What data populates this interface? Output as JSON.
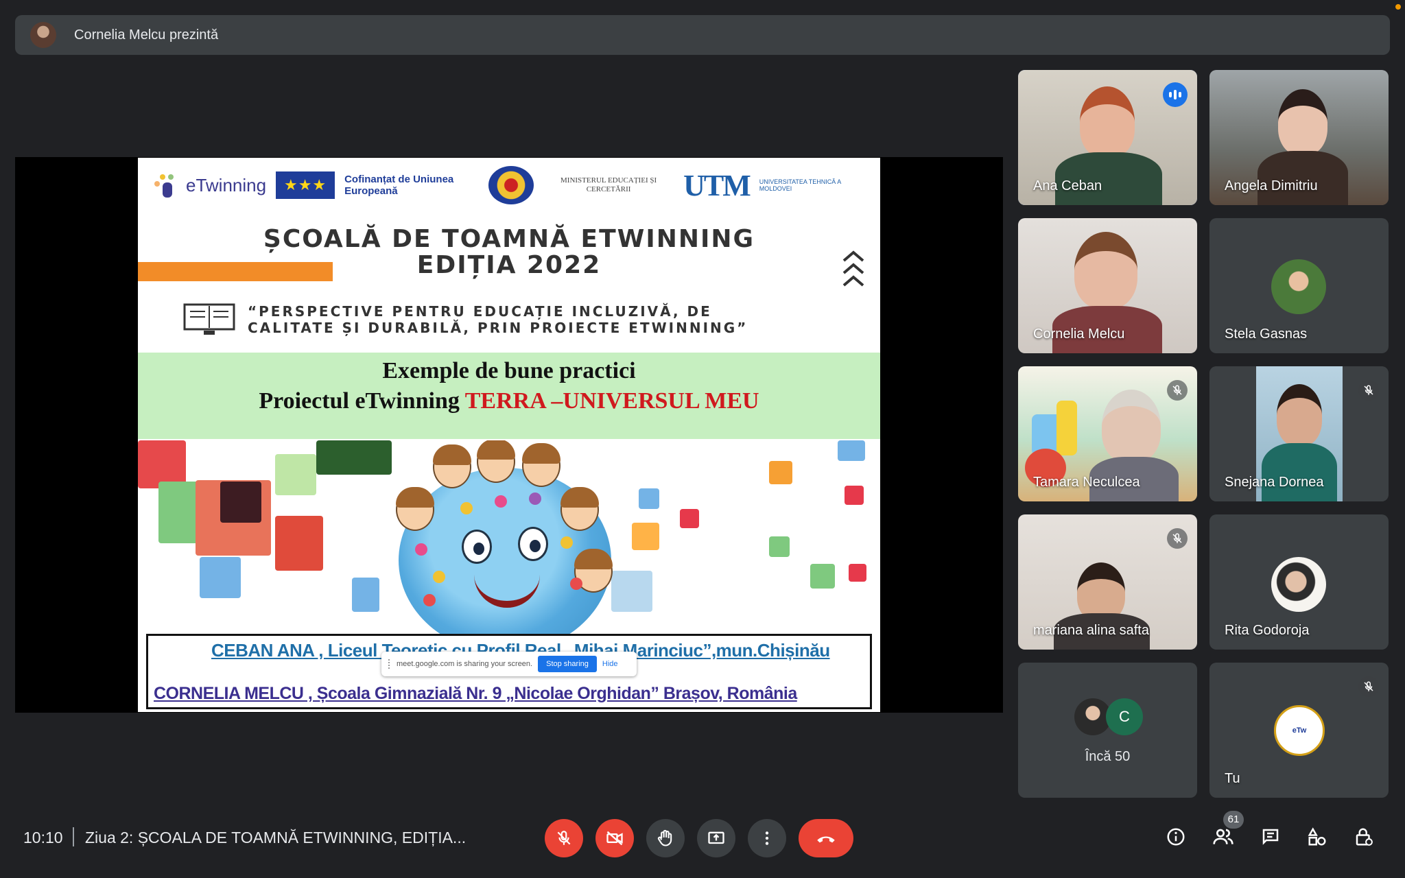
{
  "presenter": {
    "label": "Cornelia Melcu prezintă"
  },
  "slide": {
    "logos": {
      "etwinning": "eTwinning",
      "eu_text": "Cofinanțat de Uniunea Europeană",
      "ministry": "MINISTERUL EDUCAȚIEI ȘI CERCETĂRII",
      "utm": "UTM",
      "utm_text": "UNIVERSITATEA TEHNICĂ A MOLDOVEI"
    },
    "title_line1": "ȘCOALĂ DE TOAMNĂ ETWINNING",
    "title_line2": "EDIȚIA 2022",
    "subtitle_line1": "“PERSPECTIVE PENTRU EDUCAȚIE INCLUZIVĂ, DE",
    "subtitle_line2": "CALITATE ȘI DURABILĂ, PRIN PROIECTE ETWINNING”",
    "band_line1": "Exemple de bune practici",
    "band_line2_prefix": "Proiectul eTwinning ",
    "band_line2_highlight": "TERRA –UNIVERSUL MEU",
    "credit1": "CEBAN ANA , Liceul Teoretic cu Profil Real „Mihai Marinciuc”,mun.Chișinău",
    "credit2": "CORNELIA MELCU , Școala Gimnazială Nr. 9 „Nicolae Orghidan” Brașov, România"
  },
  "share_bar": {
    "message": "meet.google.com is sharing your screen.",
    "stop_label": "Stop sharing",
    "hide_label": "Hide"
  },
  "participants": [
    {
      "name": "Ana Ceban",
      "state": "speaking"
    },
    {
      "name": "Angela Dimitriu",
      "state": "video"
    },
    {
      "name": "Cornelia Melcu",
      "state": "video"
    },
    {
      "name": "Stela Gasnas",
      "state": "avatar"
    },
    {
      "name": "Tamara Neculcea",
      "state": "muted"
    },
    {
      "name": "Snejana Dornea",
      "state": "muted"
    },
    {
      "name": "mariana alina safta",
      "state": "muted"
    },
    {
      "name": "Rita Godoroja",
      "state": "avatar"
    },
    {
      "name": "Încă 50",
      "state": "overflow",
      "initial": "C"
    },
    {
      "name": "Tu",
      "state": "muted"
    }
  ],
  "bottom_bar": {
    "time": "10:10",
    "meeting_title": "Ziua 2: ȘCOALA DE TOAMNĂ ETWINNING, EDIȚIA...",
    "participant_count": "61"
  },
  "colors": {
    "background": "#202124",
    "tile": "#3c4043",
    "active_outline": "#8ab4f8",
    "danger": "#ea4335",
    "accent": "#1a73e8"
  },
  "icons": [
    "mic-off-icon",
    "camera-off-icon",
    "raise-hand-icon",
    "present-screen-icon",
    "more-options-icon",
    "end-call-icon",
    "info-icon",
    "people-icon",
    "chat-icon",
    "activities-icon",
    "host-controls-icon"
  ]
}
